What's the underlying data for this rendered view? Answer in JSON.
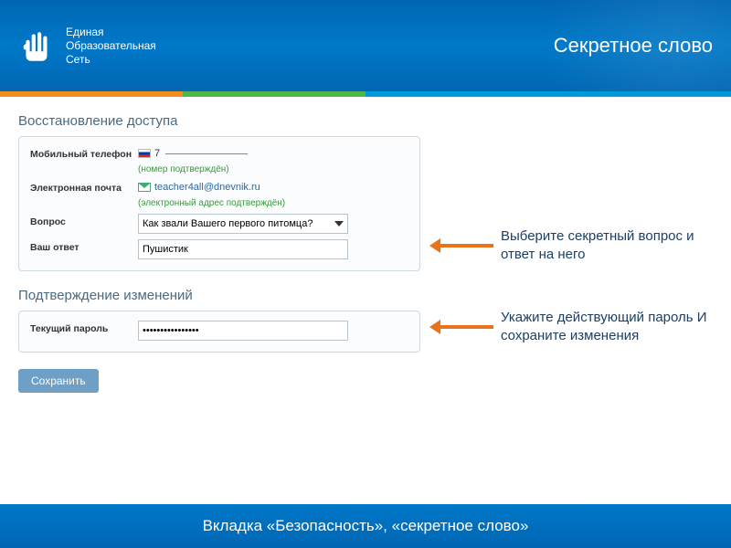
{
  "header": {
    "logo_line1": "Единая",
    "logo_line2": "Образовательная",
    "logo_line3": "Сеть",
    "title": "Секретное слово"
  },
  "recovery": {
    "title": "Восстановление доступа",
    "phone_label": "Мобильный телефон",
    "phone_value": "7",
    "phone_hint": "(номер подтверждён)",
    "email_label": "Электронная почта",
    "email_value": "teacher4all@dnevnik.ru",
    "email_hint": "(электронный адрес подтверждён)",
    "question_label": "Вопрос",
    "question_value": "Как звали Вашего первого питомца?",
    "answer_label": "Ваш ответ",
    "answer_value": "Пушистик"
  },
  "confirm": {
    "title": "Подтверждение изменений",
    "password_label": "Текущий пароль",
    "password_value": "••••••••••••••••"
  },
  "save_label": "Сохранить",
  "callouts": {
    "question": "Выберите секретный вопрос и ответ на него",
    "password": "Укажите действующий пароль И сохраните изменения"
  },
  "footer": "Вкладка «Безопасность», «секретное слово»"
}
